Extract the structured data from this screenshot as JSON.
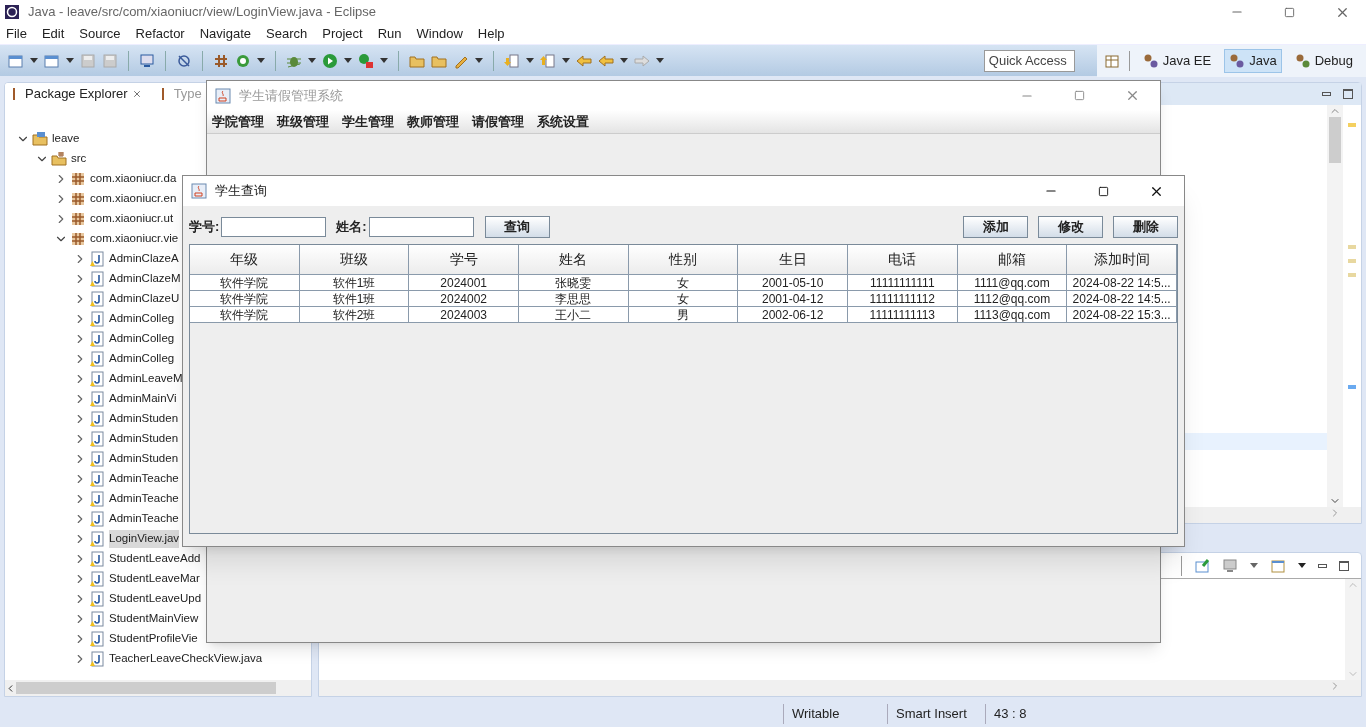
{
  "window": {
    "title": "Java - leave/src/com/xiaoniucr/view/LoginView.java - Eclipse"
  },
  "menu": [
    "File",
    "Edit",
    "Source",
    "Refactor",
    "Navigate",
    "Search",
    "Project",
    "Run",
    "Window",
    "Help"
  ],
  "quick_access": {
    "placeholder": "Quick Access"
  },
  "perspectives": [
    {
      "label": "Java EE",
      "selected": false
    },
    {
      "label": "Java",
      "selected": true
    },
    {
      "label": "Debug",
      "selected": false
    }
  ],
  "explorer": {
    "tabs": [
      {
        "label": "Package Explorer",
        "selected": true
      },
      {
        "label": "Type",
        "selected": false
      }
    ],
    "tree": [
      {
        "label": "leave",
        "kind": "project",
        "expanded": true,
        "selected": false,
        "children": [
          {
            "label": "src",
            "kind": "source",
            "expanded": true,
            "selected": false,
            "children": [
              {
                "label": "com.xiaoniucr.da",
                "kind": "package",
                "expanded": false,
                "selected": false
              },
              {
                "label": "com.xiaoniucr.en",
                "kind": "package",
                "expanded": false,
                "selected": false
              },
              {
                "label": "com.xiaoniucr.ut",
                "kind": "package",
                "expanded": false,
                "selected": false
              },
              {
                "label": "com.xiaoniucr.vie",
                "kind": "package",
                "expanded": true,
                "selected": false,
                "children": [
                  {
                    "label": "AdminClazeA",
                    "kind": "file",
                    "expanded": false,
                    "selected": false
                  },
                  {
                    "label": "AdminClazeM",
                    "kind": "file",
                    "expanded": false,
                    "selected": false
                  },
                  {
                    "label": "AdminClazeU",
                    "kind": "file",
                    "expanded": false,
                    "selected": false
                  },
                  {
                    "label": "AdminColleg",
                    "kind": "file",
                    "expanded": false,
                    "selected": false
                  },
                  {
                    "label": "AdminColleg",
                    "kind": "file",
                    "expanded": false,
                    "selected": false
                  },
                  {
                    "label": "AdminColleg",
                    "kind": "file",
                    "expanded": false,
                    "selected": false
                  },
                  {
                    "label": "AdminLeaveM",
                    "kind": "file",
                    "expanded": false,
                    "selected": false
                  },
                  {
                    "label": "AdminMainVi",
                    "kind": "file",
                    "expanded": false,
                    "selected": false
                  },
                  {
                    "label": "AdminStuden",
                    "kind": "file",
                    "expanded": false,
                    "selected": false
                  },
                  {
                    "label": "AdminStuden",
                    "kind": "file",
                    "expanded": false,
                    "selected": false
                  },
                  {
                    "label": "AdminStuden",
                    "kind": "file",
                    "expanded": false,
                    "selected": false
                  },
                  {
                    "label": "AdminTeache",
                    "kind": "file",
                    "expanded": false,
                    "selected": false
                  },
                  {
                    "label": "AdminTeache",
                    "kind": "file",
                    "expanded": false,
                    "selected": false
                  },
                  {
                    "label": "AdminTeache",
                    "kind": "file",
                    "expanded": false,
                    "selected": false
                  },
                  {
                    "label": "LoginView.jav",
                    "kind": "file",
                    "expanded": false,
                    "selected": true
                  },
                  {
                    "label": "StudentLeaveAdd",
                    "kind": "file",
                    "expanded": false,
                    "selected": false
                  },
                  {
                    "label": "StudentLeaveMar",
                    "kind": "file",
                    "expanded": false,
                    "selected": false
                  },
                  {
                    "label": "StudentLeaveUpd",
                    "kind": "file",
                    "expanded": false,
                    "selected": false
                  },
                  {
                    "label": "StudentMainView",
                    "kind": "file",
                    "expanded": false,
                    "selected": false
                  },
                  {
                    "label": "StudentProfileVie",
                    "kind": "file",
                    "expanded": false,
                    "selected": false
                  },
                  {
                    "label": "TeacherLeaveCheckView.java",
                    "kind": "file",
                    "expanded": false,
                    "selected": false
                  }
                ]
              }
            ]
          }
        ]
      }
    ]
  },
  "app_window": {
    "title": "学生请假管理系统",
    "menu": [
      "学院管理",
      "班级管理",
      "学生管理",
      "教师管理",
      "请假管理",
      "系统设置"
    ]
  },
  "query_window": {
    "title": "学生查询",
    "fields": [
      {
        "label": "学号:"
      },
      {
        "label": "姓名:"
      }
    ],
    "search_button": "查询",
    "actions": [
      "添加",
      "修改",
      "删除"
    ],
    "table": {
      "columns": [
        "年级",
        "班级",
        "学号",
        "姓名",
        "性别",
        "生日",
        "电话",
        "邮箱",
        "添加时间"
      ],
      "rows": [
        [
          "软件学院",
          "软件1班",
          "2024001",
          "张晓雯",
          "女",
          "2001-05-10",
          "11111111111",
          "1111@qq.com",
          "2024-08-22 14:5..."
        ],
        [
          "软件学院",
          "软件1班",
          "2024002",
          "李思思",
          "女",
          "2001-04-12",
          "11111111112",
          "1112@qq.com",
          "2024-08-22 14:5..."
        ],
        [
          "软件学院",
          "软件2班",
          "2024003",
          "王小二",
          "男",
          "2002-06-12",
          "11111111113",
          "1113@qq.com",
          "2024-08-22 15:3..."
        ]
      ]
    }
  },
  "status_bar": [
    "Writable",
    "Smart Insert",
    "43 : 8"
  ]
}
